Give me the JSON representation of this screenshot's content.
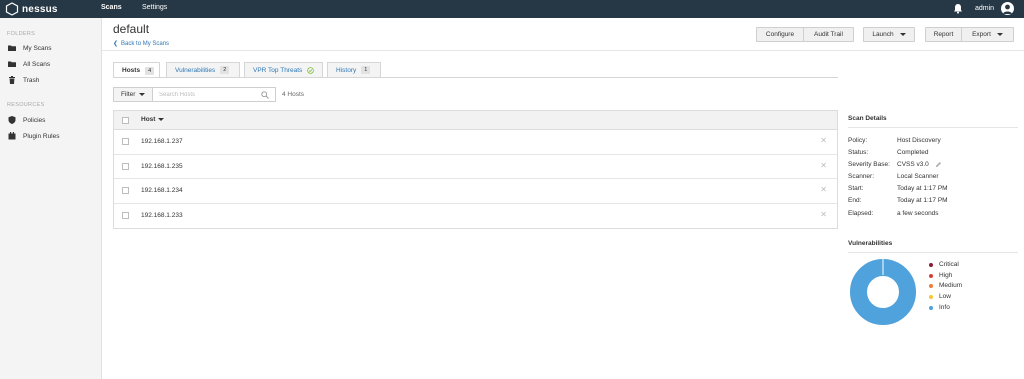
{
  "topbar": {
    "logo_text": "nessus",
    "nav": [
      {
        "label": "Scans",
        "active": true
      },
      {
        "label": "Settings",
        "active": false
      }
    ],
    "user": "admin"
  },
  "sidebar": {
    "folders_heading": "FOLDERS",
    "folders": [
      {
        "label": "My Scans",
        "icon": "folder-icon"
      },
      {
        "label": "All Scans",
        "icon": "folder-icon"
      },
      {
        "label": "Trash",
        "icon": "trash-icon"
      }
    ],
    "resources_heading": "RESOURCES",
    "resources": [
      {
        "label": "Policies",
        "icon": "shield-icon"
      },
      {
        "label": "Plugin Rules",
        "icon": "plugin-icon"
      }
    ]
  },
  "header": {
    "title": "default",
    "back_link": "Back to My Scans",
    "buttons": {
      "configure": "Configure",
      "audit_trail": "Audit Trail",
      "launch": "Launch",
      "report": "Report",
      "export": "Export"
    }
  },
  "tabs": [
    {
      "label": "Hosts",
      "count": "4",
      "active": true
    },
    {
      "label": "Vulnerabilities",
      "count": "2",
      "active": false
    },
    {
      "label": "VPR Top Threats",
      "count": "",
      "active": false
    },
    {
      "label": "History",
      "count": "1",
      "active": false
    }
  ],
  "filter": {
    "label": "Filter",
    "search_placeholder": "Search Hosts",
    "hosts_count": "4 Hosts"
  },
  "table": {
    "column_host": "Host",
    "rows": [
      "192.168.1.237",
      "192.168.1.235",
      "192.168.1.234",
      "192.168.1.233"
    ]
  },
  "scan_details": {
    "title": "Scan Details",
    "items": [
      {
        "label": "Policy:",
        "value": "Host Discovery"
      },
      {
        "label": "Status:",
        "value": "Completed"
      },
      {
        "label": "Severity Base:",
        "value": "CVSS v3.0"
      },
      {
        "label": "Scanner:",
        "value": "Local Scanner"
      },
      {
        "label": "Start:",
        "value": "Today at 1:17 PM"
      },
      {
        "label": "End:",
        "value": "Today at 1:17 PM"
      },
      {
        "label": "Elapsed:",
        "value": "a few seconds"
      }
    ]
  },
  "vulnerabilities": {
    "title": "Vulnerabilities",
    "legend": [
      {
        "label": "Critical",
        "color": "#8e1b31"
      },
      {
        "label": "High",
        "color": "#d43f3a"
      },
      {
        "label": "Medium",
        "color": "#ee7d33"
      },
      {
        "label": "Low",
        "color": "#fdc431"
      },
      {
        "label": "Info",
        "color": "#4fa2db"
      }
    ]
  },
  "colors": {
    "topbar": "#263745",
    "link": "#2e77b5",
    "info": "#4fa2db"
  }
}
